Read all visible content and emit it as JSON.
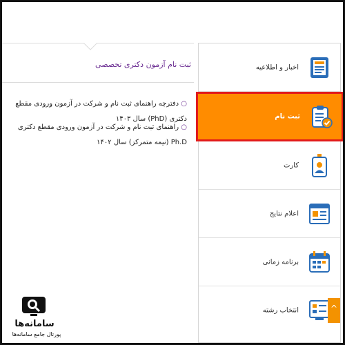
{
  "content": {
    "title": "ثبت نام آزمون دکتری تخصصی",
    "links": [
      {
        "text": "دفترچه راهنمای ثبت نام و شرکت در آزمون ورودی مقطع دکتری (PhD) سال ۱۴۰۳"
      },
      {
        "text": "راهنمای ثبت نام و شرکت در آزمون ورودی مقطع دکتری Ph.D (نیمه متمرکز) سال ۱۴۰۲"
      }
    ]
  },
  "sidebar": {
    "items": [
      {
        "label": "اخبار و اطلاعیه",
        "icon": "news-icon"
      },
      {
        "label": "ثبت نام",
        "icon": "clipboard-check-icon",
        "active": true
      },
      {
        "label": "کارت",
        "icon": "id-card-icon"
      },
      {
        "label": "اعلام نتایج",
        "icon": "results-icon"
      },
      {
        "label": "برنامه زمانی",
        "icon": "calendar-icon"
      },
      {
        "label": "انتخاب رشته",
        "icon": "field-selection-icon"
      }
    ]
  },
  "logo": {
    "brand": "سامانه‌ها",
    "tagline": "پورتال جامع سامانه‌ها"
  },
  "scroll_top": "^",
  "colors": {
    "accent": "#ff8c00",
    "active_border": "#e21b1b",
    "title": "#6a2c91",
    "icon_primary": "#2a6db8",
    "icon_secondary": "#f39200"
  }
}
